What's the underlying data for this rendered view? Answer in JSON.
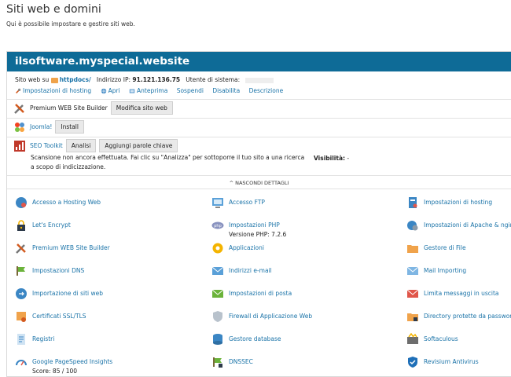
{
  "page": {
    "title": "Siti web e domini",
    "description": "Qui è possibile impostare e gestire siti web."
  },
  "site": {
    "domain": "ilsoftware.myspecial.website",
    "webroot_prefix": "Sito web su",
    "webroot": "httpdocs/",
    "ip_label": "Indirizzo IP:",
    "ip": "91.121.136.75",
    "user_label": "Utente di sistema:",
    "actions": [
      {
        "label": "Impostazioni di hosting",
        "icon": "wrench-icon"
      },
      {
        "label": "Apri",
        "icon": "globe-icon"
      },
      {
        "label": "Anteprima",
        "icon": "preview-icon"
      },
      {
        "label": "Sospendi",
        "icon": ""
      },
      {
        "label": "Disabilita",
        "icon": ""
      },
      {
        "label": "Descrizione",
        "icon": ""
      }
    ]
  },
  "tools": {
    "wsb_name": "Premium WEB Site Builder",
    "wsb_button": "Modifica sito web",
    "joomla_name": "Joomla!",
    "joomla_button": "Install",
    "seo_name": "SEO Toolkit",
    "seo_button1": "Analisi",
    "seo_button2": "Aggiungi parole chiave",
    "seo_text": "Scansione non ancora effettuata. Fai clic su \"Analizza\" per sottoporre il tuo sito a una ricerca a scopo di indicizzazione.",
    "visibility_label": "Visibilità:",
    "visibility_value": "-"
  },
  "toggle_label": "^ NASCONDI DETTAGLI",
  "grid": [
    [
      {
        "label": "Accesso a Hosting Web",
        "icon": "globe-person-icon"
      },
      {
        "label": "Accesso FTP",
        "icon": "ftp-icon"
      },
      {
        "label": "Impostazioni di hosting",
        "icon": "server-icon"
      }
    ],
    [
      {
        "label": "Let's Encrypt",
        "icon": "lock-icon"
      },
      {
        "label": "Impostazioni PHP",
        "icon": "php-icon",
        "sub": "Versione PHP: 7.2.6"
      },
      {
        "label": "Impostazioni di Apache & nginx",
        "icon": "apache-icon"
      }
    ],
    [
      {
        "label": "Premium WEB Site Builder",
        "icon": "tools-icon"
      },
      {
        "label": "Applicazioni",
        "icon": "gear-icon"
      },
      {
        "label": "Gestore di File",
        "icon": "folder-icon"
      }
    ],
    [
      {
        "label": "Impostazioni DNS",
        "icon": "dns-icon"
      },
      {
        "label": "Indirizzi e-mail",
        "icon": "mail-icon"
      },
      {
        "label": "Mail Importing",
        "icon": "mail-import-icon"
      }
    ],
    [
      {
        "label": "Importazione di siti web",
        "icon": "import-icon"
      },
      {
        "label": "Impostazioni di posta",
        "icon": "mail-settings-icon"
      },
      {
        "label": "Limita messaggi in uscita",
        "icon": "mail-limit-icon"
      }
    ],
    [
      {
        "label": "Certificati SSL/TLS",
        "icon": "certificate-icon"
      },
      {
        "label": "Firewall di Applicazione Web",
        "icon": "shield-icon"
      },
      {
        "label": "Directory protette da password",
        "icon": "protected-folder-icon"
      }
    ],
    [
      {
        "label": "Registri",
        "icon": "log-icon"
      },
      {
        "label": "Gestore database",
        "icon": "database-icon"
      },
      {
        "label": "Softaculous",
        "icon": "softaculous-icon"
      }
    ],
    [
      {
        "label": "Google PageSpeed Insights",
        "icon": "pagespeed-icon",
        "sub": "Score: 85 / 100"
      },
      {
        "label": "DNSSEC",
        "icon": "dnssec-icon"
      },
      {
        "label": "Revisium Antivirus",
        "icon": "antivirus-icon"
      }
    ]
  ]
}
